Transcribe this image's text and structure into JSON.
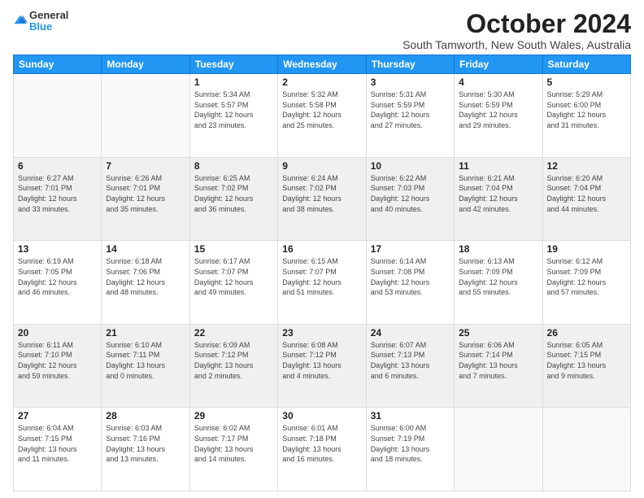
{
  "logo": {
    "general": "General",
    "blue": "Blue"
  },
  "header": {
    "month": "October 2024",
    "location": "South Tamworth, New South Wales, Australia"
  },
  "weekdays": [
    "Sunday",
    "Monday",
    "Tuesday",
    "Wednesday",
    "Thursday",
    "Friday",
    "Saturday"
  ],
  "weeks": [
    [
      {
        "day": "",
        "info": ""
      },
      {
        "day": "",
        "info": ""
      },
      {
        "day": "1",
        "info": "Sunrise: 5:34 AM\nSunset: 5:57 PM\nDaylight: 12 hours\nand 23 minutes."
      },
      {
        "day": "2",
        "info": "Sunrise: 5:32 AM\nSunset: 5:58 PM\nDaylight: 12 hours\nand 25 minutes."
      },
      {
        "day": "3",
        "info": "Sunrise: 5:31 AM\nSunset: 5:59 PM\nDaylight: 12 hours\nand 27 minutes."
      },
      {
        "day": "4",
        "info": "Sunrise: 5:30 AM\nSunset: 5:59 PM\nDaylight: 12 hours\nand 29 minutes."
      },
      {
        "day": "5",
        "info": "Sunrise: 5:29 AM\nSunset: 6:00 PM\nDaylight: 12 hours\nand 31 minutes."
      }
    ],
    [
      {
        "day": "6",
        "info": "Sunrise: 6:27 AM\nSunset: 7:01 PM\nDaylight: 12 hours\nand 33 minutes."
      },
      {
        "day": "7",
        "info": "Sunrise: 6:26 AM\nSunset: 7:01 PM\nDaylight: 12 hours\nand 35 minutes."
      },
      {
        "day": "8",
        "info": "Sunrise: 6:25 AM\nSunset: 7:02 PM\nDaylight: 12 hours\nand 36 minutes."
      },
      {
        "day": "9",
        "info": "Sunrise: 6:24 AM\nSunset: 7:02 PM\nDaylight: 12 hours\nand 38 minutes."
      },
      {
        "day": "10",
        "info": "Sunrise: 6:22 AM\nSunset: 7:03 PM\nDaylight: 12 hours\nand 40 minutes."
      },
      {
        "day": "11",
        "info": "Sunrise: 6:21 AM\nSunset: 7:04 PM\nDaylight: 12 hours\nand 42 minutes."
      },
      {
        "day": "12",
        "info": "Sunrise: 6:20 AM\nSunset: 7:04 PM\nDaylight: 12 hours\nand 44 minutes."
      }
    ],
    [
      {
        "day": "13",
        "info": "Sunrise: 6:19 AM\nSunset: 7:05 PM\nDaylight: 12 hours\nand 46 minutes."
      },
      {
        "day": "14",
        "info": "Sunrise: 6:18 AM\nSunset: 7:06 PM\nDaylight: 12 hours\nand 48 minutes."
      },
      {
        "day": "15",
        "info": "Sunrise: 6:17 AM\nSunset: 7:07 PM\nDaylight: 12 hours\nand 49 minutes."
      },
      {
        "day": "16",
        "info": "Sunrise: 6:15 AM\nSunset: 7:07 PM\nDaylight: 12 hours\nand 51 minutes."
      },
      {
        "day": "17",
        "info": "Sunrise: 6:14 AM\nSunset: 7:08 PM\nDaylight: 12 hours\nand 53 minutes."
      },
      {
        "day": "18",
        "info": "Sunrise: 6:13 AM\nSunset: 7:09 PM\nDaylight: 12 hours\nand 55 minutes."
      },
      {
        "day": "19",
        "info": "Sunrise: 6:12 AM\nSunset: 7:09 PM\nDaylight: 12 hours\nand 57 minutes."
      }
    ],
    [
      {
        "day": "20",
        "info": "Sunrise: 6:11 AM\nSunset: 7:10 PM\nDaylight: 12 hours\nand 59 minutes."
      },
      {
        "day": "21",
        "info": "Sunrise: 6:10 AM\nSunset: 7:11 PM\nDaylight: 13 hours\nand 0 minutes."
      },
      {
        "day": "22",
        "info": "Sunrise: 6:09 AM\nSunset: 7:12 PM\nDaylight: 13 hours\nand 2 minutes."
      },
      {
        "day": "23",
        "info": "Sunrise: 6:08 AM\nSunset: 7:12 PM\nDaylight: 13 hours\nand 4 minutes."
      },
      {
        "day": "24",
        "info": "Sunrise: 6:07 AM\nSunset: 7:13 PM\nDaylight: 13 hours\nand 6 minutes."
      },
      {
        "day": "25",
        "info": "Sunrise: 6:06 AM\nSunset: 7:14 PM\nDaylight: 13 hours\nand 7 minutes."
      },
      {
        "day": "26",
        "info": "Sunrise: 6:05 AM\nSunset: 7:15 PM\nDaylight: 13 hours\nand 9 minutes."
      }
    ],
    [
      {
        "day": "27",
        "info": "Sunrise: 6:04 AM\nSunset: 7:15 PM\nDaylight: 13 hours\nand 11 minutes."
      },
      {
        "day": "28",
        "info": "Sunrise: 6:03 AM\nSunset: 7:16 PM\nDaylight: 13 hours\nand 13 minutes."
      },
      {
        "day": "29",
        "info": "Sunrise: 6:02 AM\nSunset: 7:17 PM\nDaylight: 13 hours\nand 14 minutes."
      },
      {
        "day": "30",
        "info": "Sunrise: 6:01 AM\nSunset: 7:18 PM\nDaylight: 13 hours\nand 16 minutes."
      },
      {
        "day": "31",
        "info": "Sunrise: 6:00 AM\nSunset: 7:19 PM\nDaylight: 13 hours\nand 18 minutes."
      },
      {
        "day": "",
        "info": ""
      },
      {
        "day": "",
        "info": ""
      }
    ]
  ]
}
